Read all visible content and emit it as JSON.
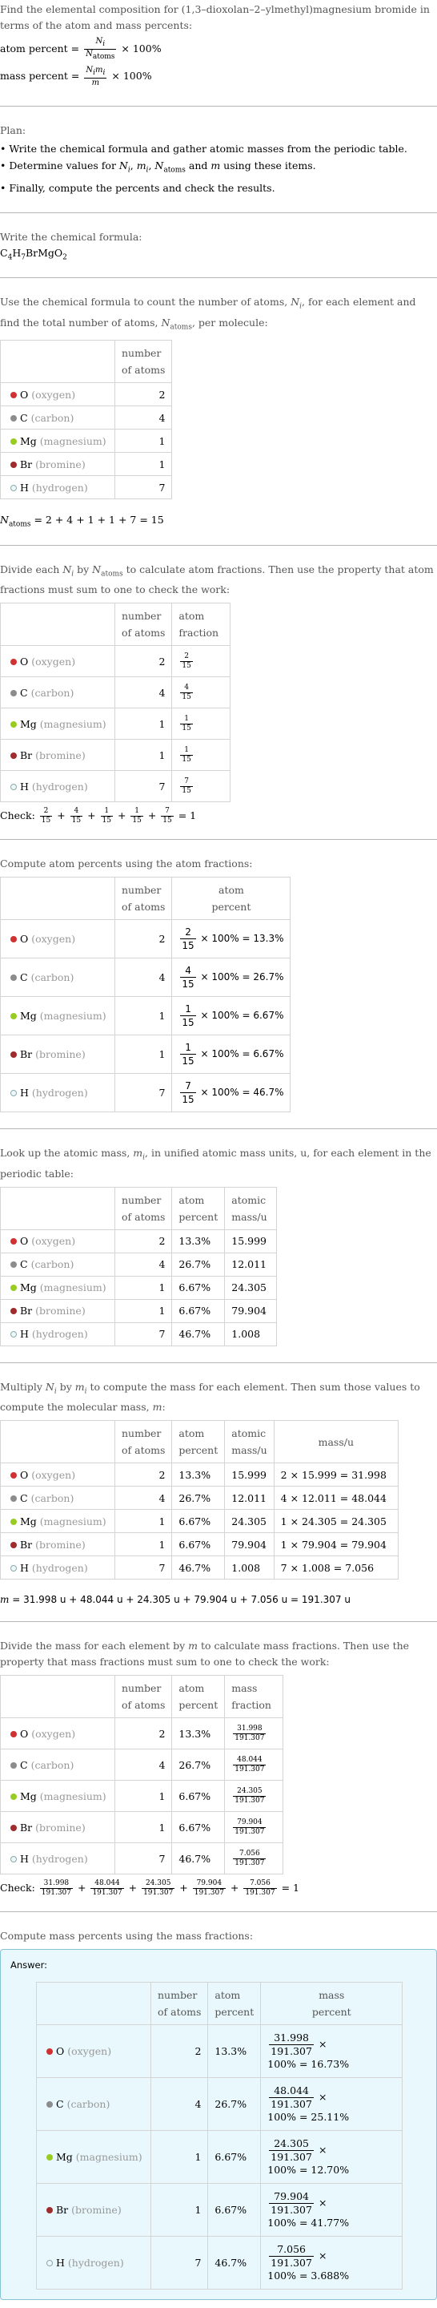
{
  "intro": {
    "question": "Find the elemental composition for (1,3–dioxolan–2–ylmethyl)magnesium bromide in terms of the atom and mass percents:",
    "atom_percent_label": "atom percent =",
    "mass_percent_label": "mass percent =",
    "times_100": "× 100%"
  },
  "plan": {
    "title": "Plan:",
    "items": [
      "Write the chemical formula and gather atomic masses from the periodic table.",
      "Determine values for N_i, m_i, N_atoms and m using these items.",
      "Finally, compute the percents and check the results."
    ]
  },
  "formula": {
    "lead": "Write the chemical formula:",
    "parts": [
      {
        "t": "C",
        "sub": "4"
      },
      {
        "t": "H",
        "sub": "7"
      },
      {
        "t": "BrMgO",
        "sub": "2"
      }
    ]
  },
  "elements": [
    {
      "symbol": "O",
      "name": "(oxygen)",
      "color": "#d03131",
      "count": "2",
      "fraction_num": "2",
      "fraction_den": "15",
      "atom_percent": "13.3%",
      "atomic_mass": "15.999",
      "mass_expr": "2 × 15.999 = 31.998",
      "mass": "31.998",
      "mass_percent_result": "100% = 16.73%"
    },
    {
      "symbol": "C",
      "name": "(carbon)",
      "color": "#8c8c8c",
      "count": "4",
      "fraction_num": "4",
      "fraction_den": "15",
      "atom_percent": "26.7%",
      "atomic_mass": "12.011",
      "mass_expr": "4 × 12.011 = 48.044",
      "mass": "48.044",
      "mass_percent_result": "100% = 25.11%"
    },
    {
      "symbol": "Mg",
      "name": "(magnesium)",
      "color": "#99cc22",
      "count": "1",
      "fraction_num": "1",
      "fraction_den": "15",
      "atom_percent": "6.67%",
      "atomic_mass": "24.305",
      "mass_expr": "1 × 24.305 = 24.305",
      "mass": "24.305",
      "mass_percent_result": "100% = 12.70%"
    },
    {
      "symbol": "Br",
      "name": "(bromine)",
      "color": "#a02b2b",
      "count": "1",
      "fraction_num": "1",
      "fraction_den": "15",
      "atom_percent": "6.67%",
      "atomic_mass": "79.904",
      "mass_expr": "1 × 79.904 = 79.904",
      "mass": "79.904",
      "mass_percent_result": "100% = 41.77%"
    },
    {
      "symbol": "H",
      "name": "(hydrogen)",
      "color": "#eef8fb",
      "count": "7",
      "fraction_num": "7",
      "fraction_den": "15",
      "atom_percent": "46.7%",
      "atomic_mass": "1.008",
      "mass_expr": "7 × 1.008 = 7.056",
      "mass": "7.056",
      "mass_percent_result": "100% = 3.688%"
    }
  ],
  "step_count": {
    "lead": "Use the chemical formula to count the number of atoms, N_i, for each element and find the total number of atoms, N_atoms, per molecule:",
    "header_count": "number of atoms",
    "total_expr": "= 2 + 4 + 1 + 1 + 7 = 15"
  },
  "step_fraction": {
    "lead": "Divide each N_i by N_atoms to calculate atom fractions. Then use the property that atom fractions must sum to one to check the work:",
    "header_fraction": "atom fraction",
    "check_label": "Check:",
    "check_result": "= 1"
  },
  "step_atom_percent": {
    "lead": "Compute atom percents using the atom fractions:",
    "header_percent": "atom percent",
    "suffixes": [
      "× 100% = 13.3%",
      "× 100% = 26.7%",
      "× 100% = 6.67%",
      "× 100% = 6.67%",
      "× 100% = 46.7%"
    ]
  },
  "step_lookup": {
    "lead": "Look up the atomic mass, m_i, in unified atomic mass units, u, for each element in the periodic table:",
    "header_atomic_mass": "atomic mass/u"
  },
  "step_mass": {
    "lead": "Multiply N_i by m_i to compute the mass for each element. Then sum those values to compute the molecular mass, m:",
    "header_mass": "mass/u",
    "total_expr": "= 31.998 u + 48.044 u + 24.305 u + 79.904 u + 7.056 u = 191.307 u"
  },
  "step_mass_fraction": {
    "lead": "Divide the mass for each element by m to calculate mass fractions. Then use the property that mass fractions must sum to one to check the work:",
    "header_mass_fraction": "mass fraction",
    "denominator": "191.307",
    "check_label": "Check:",
    "check_result": "= 1"
  },
  "step_mass_percent": {
    "lead": "Compute mass percents using the mass fractions:",
    "answer_label": "Answer:",
    "header_mass_percent": "mass percent",
    "times": "×"
  }
}
